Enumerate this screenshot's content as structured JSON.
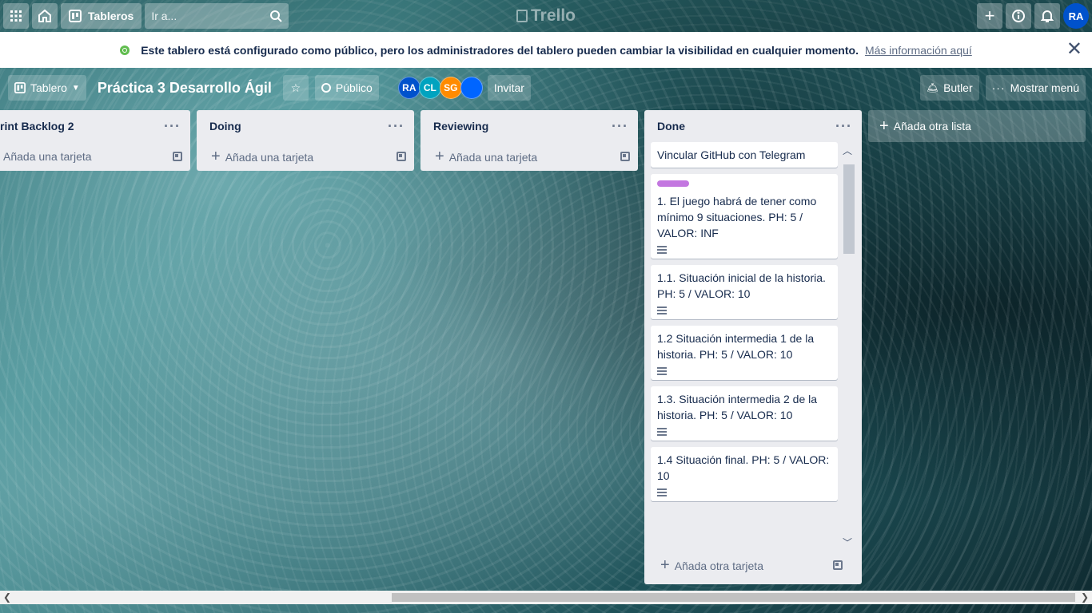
{
  "topbar": {
    "boards_label": "Tableros",
    "search_placeholder": "Ir a...",
    "logo_text": "Trello",
    "user_initials": "RA"
  },
  "banner": {
    "message": "Este tablero está configurado como público, pero los administradores del tablero pueden cambiar la visibilidad en cualquier momento.",
    "link": "Más información aquí"
  },
  "board": {
    "view_label": "Tablero",
    "title": "Práctica 3 Desarrollo Ágil",
    "visibility": "Público",
    "members": [
      {
        "initials": "RA",
        "color": "#0052cc"
      },
      {
        "initials": "CL",
        "color": "#00a3bf"
      },
      {
        "initials": "SG",
        "color": "#ff8b00"
      },
      {
        "initials": "",
        "color": "#0065ff"
      }
    ],
    "invite_label": "Invitar",
    "butler_label": "Butler",
    "menu_label": "Mostrar menú"
  },
  "lists": [
    {
      "title": "rint Backlog 2",
      "add_label": "Añada una tarjeta"
    },
    {
      "title": "Doing",
      "add_label": "Añada una tarjeta"
    },
    {
      "title": "Reviewing",
      "add_label": "Añada una tarjeta"
    }
  ],
  "done": {
    "title": "Done",
    "cards": [
      {
        "text": "Vincular GitHub con Telegram",
        "label_color": "",
        "has_desc": false
      },
      {
        "text": "1. El juego habrá de tener como mínimo 9 situaciones. PH: 5 / VALOR: INF",
        "label_color": "#c377e0",
        "has_desc": true
      },
      {
        "text": "1.1. Situación inicial de la historia. PH: 5 / VALOR: 10",
        "label_color": "",
        "has_desc": true
      },
      {
        "text": "1.2 Situación intermedia 1 de la historia. PH: 5 / VALOR: 10",
        "label_color": "",
        "has_desc": true
      },
      {
        "text": "1.3. Situación intermedia 2 de la historia. PH: 5 / VALOR: 10",
        "label_color": "",
        "has_desc": true
      },
      {
        "text": "1.4 Situación final. PH: 5 / VALOR: 10",
        "label_color": "",
        "has_desc": true
      }
    ],
    "add_label": "Añada otra tarjeta"
  },
  "add_list_label": "Añada otra lista"
}
